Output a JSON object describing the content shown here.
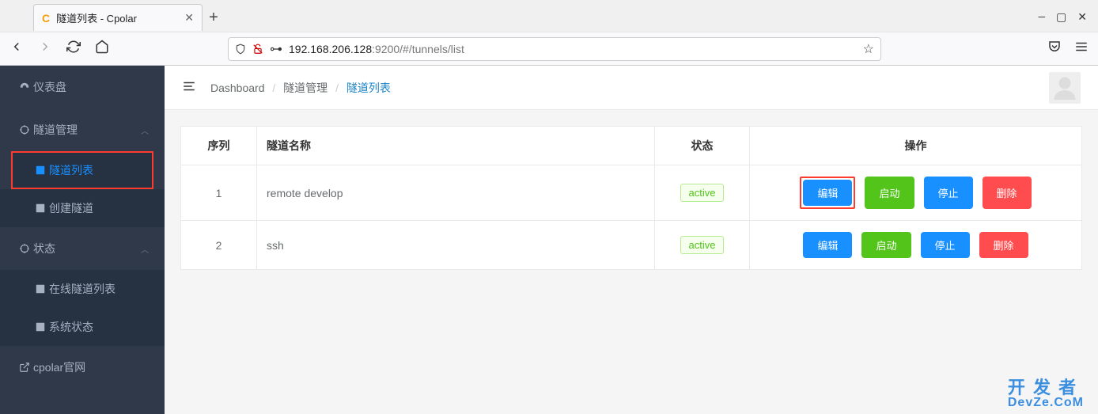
{
  "browser": {
    "tab_title": "隧道列表 - Cpolar",
    "url_host": "192.168.206.128",
    "url_port_path": ":9200/#/tunnels/list"
  },
  "sidebar": {
    "dashboard": "仪表盘",
    "tunnel_mgmt": "隧道管理",
    "tunnel_list": "隧道列表",
    "create_tunnel": "创建隧道",
    "status": "状态",
    "online_list": "在线隧道列表",
    "sys_status": "系统状态",
    "official": "cpolar官网"
  },
  "breadcrumb": {
    "dashboard": "Dashboard",
    "mgmt": "隧道管理",
    "current": "隧道列表"
  },
  "table": {
    "headers": {
      "seq": "序列",
      "name": "隧道名称",
      "status": "状态",
      "actions": "操作"
    },
    "status_label": "active",
    "actions": {
      "edit": "编辑",
      "start": "启动",
      "stop": "停止",
      "delete": "删除"
    },
    "rows": [
      {
        "seq": "1",
        "name": "remote develop"
      },
      {
        "seq": "2",
        "name": "ssh"
      }
    ]
  },
  "watermark": {
    "line1": "开 发 者",
    "line2": "DevZe.CoM"
  }
}
